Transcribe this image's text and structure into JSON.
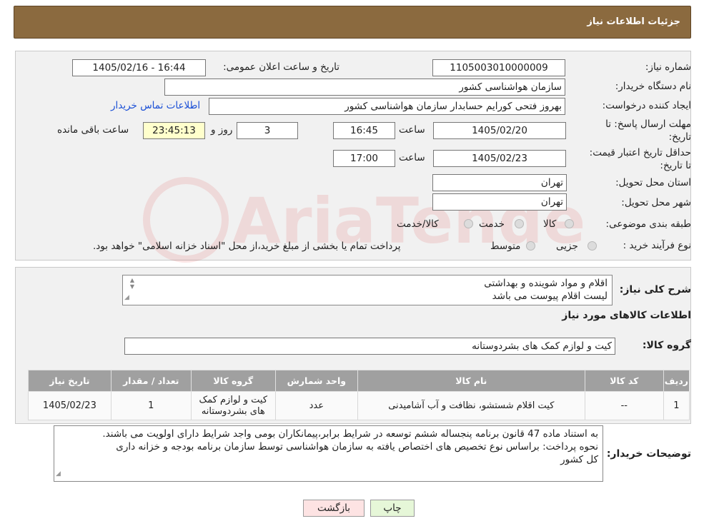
{
  "header": {
    "title": "جزئیات اطلاعات نیاز"
  },
  "form": {
    "need_number_label": "شماره نیاز:",
    "need_number": "1105003010000009",
    "announce_label": "تاریخ و ساعت اعلان عمومی:",
    "announce_value": "1405/02/16 - 16:44",
    "buyer_org_label": "نام دستگاه خریدار:",
    "buyer_org": "سازمان هواشناسی کشور",
    "creator_label": "ایجاد کننده درخواست:",
    "creator": "بهروز فتحی کورایم حسابدار سازمان هواشناسی کشور",
    "contact_link": "اطلاعات تماس خریدار",
    "reply_deadline_label": "مهلت ارسال پاسخ: تا تاریخ:",
    "reply_date": "1405/02/20",
    "time_label": "ساعت",
    "reply_time": "16:45",
    "days": "3",
    "days_label": "روز و",
    "remaining": "23:45:13",
    "remaining_label": "ساعت باقی مانده",
    "price_valid_label": "حداقل تاریخ اعتبار قیمت: تا تاریخ:",
    "price_valid_date": "1405/02/23",
    "price_valid_time": "17:00",
    "province_label": "استان محل تحویل:",
    "province": "تهران",
    "city_label": "شهر محل تحویل:",
    "city": "تهران",
    "category_label": "طبقه بندی موضوعی:",
    "category_options": [
      "کالا",
      "خدمت",
      "کالا/خدمت"
    ],
    "process_label": "نوع فرآیند خرید :",
    "process_options": [
      "جزیی",
      "متوسط"
    ],
    "process_note": "پرداخت تمام یا بخشی از مبلغ خرید،از محل \"اسناد خزانه اسلامی\" خواهد بود."
  },
  "summary": {
    "desc_label": "شرح کلی نیاز:",
    "desc_lines": [
      "اقلام و مواد شوینده و بهداشتی",
      "لیست اقلام پیوست می باشد"
    ],
    "goods_info_title": "اطلاعات کالاهای مورد نیاز",
    "goods_group_label": "گروه کالا:",
    "goods_group": "کیت و لوازم کمک های بشردوستانه"
  },
  "table": {
    "headers": [
      "ردیف",
      "کد کالا",
      "نام کالا",
      "واحد شمارش",
      "گروه کالا",
      "تعداد / مقدار",
      "تاریخ نیاز"
    ],
    "rows": [
      [
        "1",
        "--",
        "کیت اقلام شستشو، نظافت و آب آشامیدنی",
        "عدد",
        "کیت و لوازم کمک های بشردوستانه",
        "1",
        "1405/02/23"
      ]
    ]
  },
  "buyer_notes": {
    "label": "توضیحات خریدار:",
    "lines": [
      "به استناد ماده 47 قانون برنامه پنجساله ششم توسعه در شرایط برابر،پیمانکاران بومی واجد شرایط دارای اولویت می باشند.",
      "نحوه پرداخت: براساس نوع تخصیص های اختصاص یافته به سازمان هواشناسی توسط سازمان برنامه بودجه و خزانه داری",
      "کل کشور"
    ]
  },
  "buttons": {
    "print": "چاپ",
    "back": "بازگشت"
  },
  "watermark_text": "AriaTender.neT",
  "colors": {
    "header_bg": "#8b6a3f",
    "link": "#1a4fd6",
    "remaining_bg": "#ffffcc",
    "print_bg": "#e6f7d8",
    "back_bg": "#fde3e3"
  }
}
